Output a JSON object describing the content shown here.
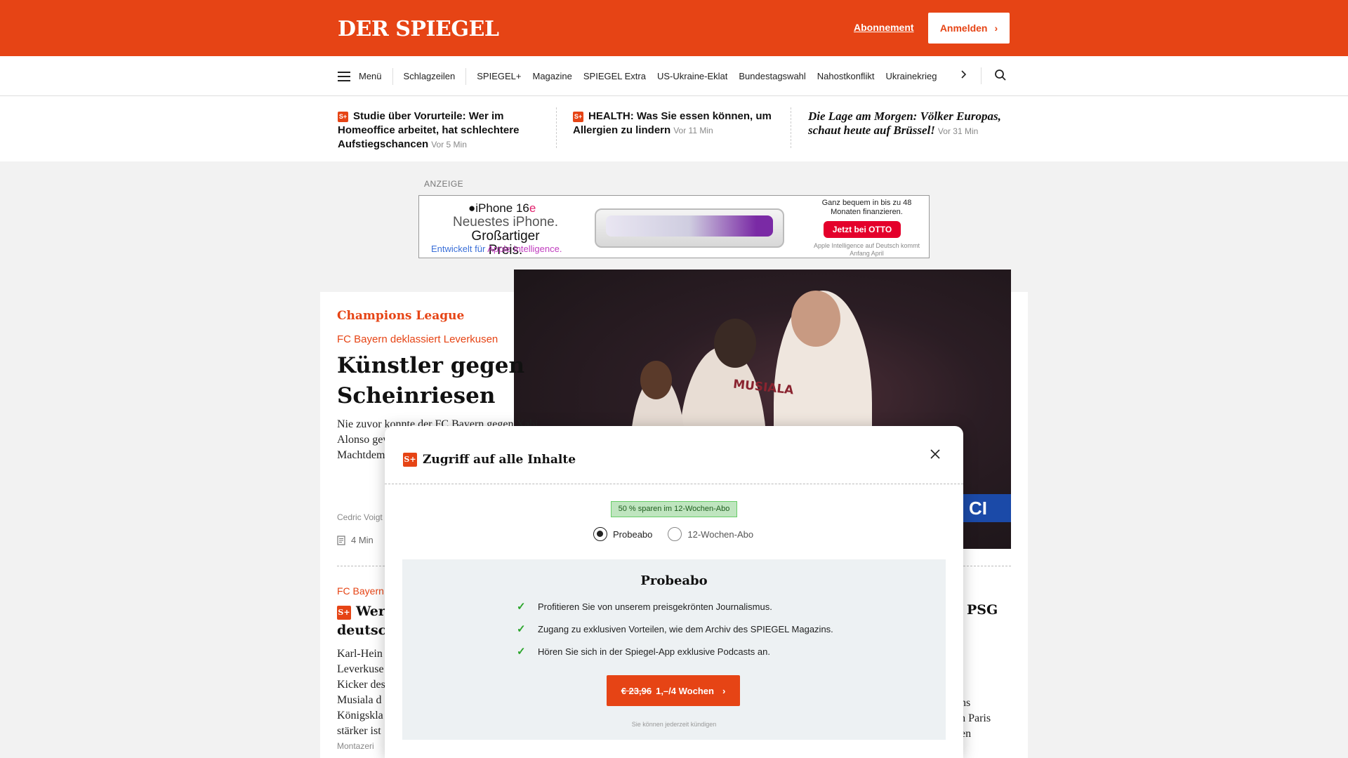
{
  "header": {
    "logo": "DER SPIEGEL",
    "subscription_link": "Abonnement",
    "login_button": "Anmelden",
    "login_chevron": "›",
    "brand_color": "#e64415"
  },
  "nav": {
    "menu_label": "Menü",
    "items": [
      "Schlagzeilen",
      "SPIEGEL+",
      "Magazine",
      "SPIEGEL Extra",
      "US-Ukraine-Eklat",
      "Bundestagswahl",
      "Nahostkonflikt",
      "Ukrainekrieg"
    ],
    "more_icon": "chevron-right-icon",
    "search_icon": "search-icon"
  },
  "newsbar": [
    {
      "badge": "S+",
      "title": "Studie über Vorurteile: Wer im Homeoffice arbeitet, hat schlechtere Aufstiegschancen",
      "time": "Vor 5 Min"
    },
    {
      "badge": "S+",
      "title": "HEALTH: Was Sie essen können, um Allergien zu lindern",
      "time": "Vor 11 Min"
    },
    {
      "title": "Die Lage am Morgen: Völker Europas, schaut heute auf Brüssel!",
      "time": "Vor 31 Min"
    }
  ],
  "ad": {
    "label": "ANZEIGE",
    "product_prefix": "iPhone 16",
    "product_suffix": "e",
    "line1": "Neuestes iPhone.",
    "line2": "Großartiger Preis.",
    "tagline_prefix": "Entwickelt für",
    "tagline_brand": "Apple Intelligence.",
    "finance_text": "Ganz bequem in bis zu 48 Monaten finanzieren.",
    "otto_button": "Jetzt bei OTTO",
    "disclaimer": "Apple Intelligence auf Deutsch kommt Anfang April"
  },
  "lead": {
    "section": "Champions League",
    "kicker": "FC Bayern deklassiert Leverkusen",
    "headline": "Künstler gegen Scheinriesen",
    "teaser": "Nie zuvor konnte der FC Bayern gegen Xabi Alonso gewinnen. Doch das Machtdemonstration sich selbst Schleichende",
    "author": "Cedric Voigt",
    "reading_time": "4 Min",
    "image_text": "MUSIALA"
  },
  "second": {
    "kicker": "FC Bayern",
    "headline_visible": "Wer",
    "headline_line2": "deutsch",
    "teaser": "Karl-Hein Leverkuse Kicker des Musiala d Königskla stärker ist",
    "author": "Montazeri",
    "right_headline": "PSG",
    "right_teaser_1": "ons",
    "right_teaser_2": "en Paris",
    "right_teaser_3": "den"
  },
  "modal": {
    "title": "Zugriff auf alle Inhalte",
    "badge": "50 % sparen im 12-Wochen-Abo",
    "options": [
      {
        "label": "Probeabo",
        "selected": true
      },
      {
        "label": "12-Wochen-Abo",
        "selected": false
      }
    ],
    "panel_title": "Probeabo",
    "features": [
      "Profitieren Sie von unserem preisgekrönten Journalismus.",
      "Zugang zu exklusiven Vorteilen, wie dem Archiv des SPIEGEL Magazins.",
      "Hören Sie sich in der Spiegel-App exklusive Podcasts an."
    ],
    "cta_old_price": "€ 23,96",
    "cta_new_price": "1,–/4 Wochen",
    "cta_chevron": "›",
    "cancel_note": "Sie können jederzeit kündigen",
    "close_icon": "close-icon"
  }
}
